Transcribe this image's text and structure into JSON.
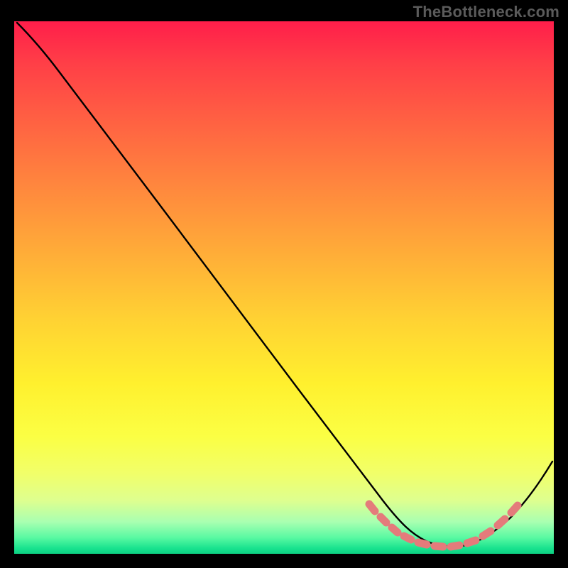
{
  "watermark": "TheBottleneck.com",
  "colors": {
    "background": "#000000",
    "curve": "#000000",
    "dash": "#e47b7b"
  },
  "chart_data": {
    "type": "line",
    "title": "",
    "xlabel": "",
    "ylabel": "",
    "xlim": [
      0,
      100
    ],
    "ylim": [
      0,
      100
    ],
    "grid": false,
    "legend": false,
    "series": [
      {
        "name": "bottleneck-curve",
        "x": [
          0,
          4,
          10,
          18,
          26,
          34,
          42,
          50,
          58,
          64,
          68,
          72,
          76,
          80,
          84,
          88,
          92,
          96,
          100
        ],
        "y": [
          100,
          97,
          91,
          81,
          71,
          61,
          51,
          41,
          31,
          21,
          13,
          7,
          3,
          1,
          1,
          3,
          7,
          14,
          23
        ]
      }
    ],
    "highlight_segment": {
      "name": "optimal-range-dashes",
      "x_from": 66,
      "x_to": 92,
      "style": "dashed-markers"
    },
    "background_gradient": {
      "top": "#ff1e4a",
      "mid": "#fff02e",
      "bottom": "#0cd183",
      "meaning": "red=high bottleneck, yellow=moderate, green=optimal"
    }
  }
}
